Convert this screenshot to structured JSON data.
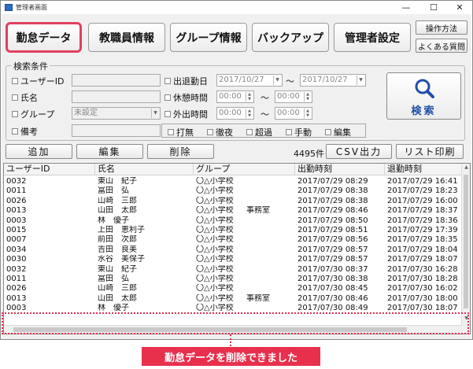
{
  "window": {
    "title": "管理者画面",
    "controls": [
      "—",
      "☐",
      "✕"
    ]
  },
  "tabs": [
    {
      "label": "勤怠データ",
      "active": true
    },
    {
      "label": "教職員情報",
      "active": false
    },
    {
      "label": "グループ情報",
      "active": false
    },
    {
      "label": "バックアップ",
      "active": false
    },
    {
      "label": "管理者設定",
      "active": false
    }
  ],
  "side_buttons": {
    "operation": "操作方法",
    "faq": "よくある質問"
  },
  "search": {
    "group_title": "検索条件",
    "user_id_label": "ユーザーID",
    "name_label": "氏名",
    "group_label": "グループ",
    "group_value": "未設定",
    "note_label": "備考",
    "attendance_date_label": "出退勤日",
    "date_from": "2017/10/27",
    "date_to": "2017/10/27",
    "range_sep": "～",
    "break_label": "休憩時間",
    "break_from": "00:00",
    "break_to": "00:00",
    "out_label": "外出時間",
    "out_from": "00:00",
    "out_to": "00:00",
    "options": [
      "打無",
      "徹夜",
      "超過",
      "手動",
      "編集"
    ],
    "search_button": "検索",
    "search_icon": "magnifier-icon"
  },
  "actions": {
    "add": "追加",
    "edit": "編集",
    "delete": "削除",
    "count": "4495件",
    "csv": "CSV出力",
    "print": "リスト印刷"
  },
  "table": {
    "headers": [
      "ユーザーID",
      "氏名",
      "グループ",
      "出勤時刻",
      "退勤時刻"
    ],
    "rows": [
      {
        "id": "0032",
        "name": "東山　紀子",
        "group": "〇△小学校",
        "dept": "",
        "in": "2017/07/29 08:29",
        "out": "2017/07/29 16:41"
      },
      {
        "id": "0011",
        "name": "冨田　弘",
        "group": "〇△小学校",
        "dept": "",
        "in": "2017/07/29 08:38",
        "out": "2017/07/29 18:23"
      },
      {
        "id": "0026",
        "name": "山崎　三郎",
        "group": "〇△小学校",
        "dept": "",
        "in": "2017/07/29 08:38",
        "out": "2017/07/29 16:00"
      },
      {
        "id": "0013",
        "name": "山田　太郎",
        "group": "〇△小学校",
        "dept": "事務室",
        "in": "2017/07/29 08:46",
        "out": "2017/07/29 18:37"
      },
      {
        "id": "0003",
        "name": "林　優子",
        "group": "〇△小学校",
        "dept": "",
        "in": "2017/07/29 08:50",
        "out": "2017/07/29 18:36"
      },
      {
        "id": "0015",
        "name": "上田　恵利子",
        "group": "〇△小学校",
        "dept": "",
        "in": "2017/07/29 08:51",
        "out": "2017/07/29 17:39"
      },
      {
        "id": "0007",
        "name": "前田　次郎",
        "group": "〇△小学校",
        "dept": "",
        "in": "2017/07/29 08:56",
        "out": "2017/07/29 18:35"
      },
      {
        "id": "0034",
        "name": "吉田　良美",
        "group": "〇△小学校",
        "dept": "",
        "in": "2017/07/29 08:57",
        "out": "2017/07/29 18:04"
      },
      {
        "id": "0030",
        "name": "水谷　美保子",
        "group": "〇△小学校",
        "dept": "",
        "in": "2017/07/29 08:57",
        "out": "2017/07/29 18:07"
      },
      {
        "id": "0032",
        "name": "東山　紀子",
        "group": "〇△小学校",
        "dept": "",
        "in": "2017/07/30 08:37",
        "out": "2017/07/30 16:28"
      },
      {
        "id": "0011",
        "name": "冨田　弘",
        "group": "〇△小学校",
        "dept": "",
        "in": "2017/07/30 08:38",
        "out": "2017/07/30 18:28"
      },
      {
        "id": "0026",
        "name": "山崎　三郎",
        "group": "〇△小学校",
        "dept": "",
        "in": "2017/07/30 08:45",
        "out": "2017/07/30 16:02"
      },
      {
        "id": "0013",
        "name": "山田　太郎",
        "group": "〇△小学校",
        "dept": "事務室",
        "in": "2017/07/30 08:46",
        "out": "2017/07/30 18:00"
      },
      {
        "id": "0003",
        "name": "林　優子",
        "group": "〇△小学校",
        "dept": "",
        "in": "2017/07/30 08:49",
        "out": "2017/07/30 18:07"
      }
    ]
  },
  "notice": {
    "text": "勤怠データを削除できました"
  },
  "colors": {
    "accent": "#e8304d",
    "window_bg": "#f0f0f0"
  }
}
